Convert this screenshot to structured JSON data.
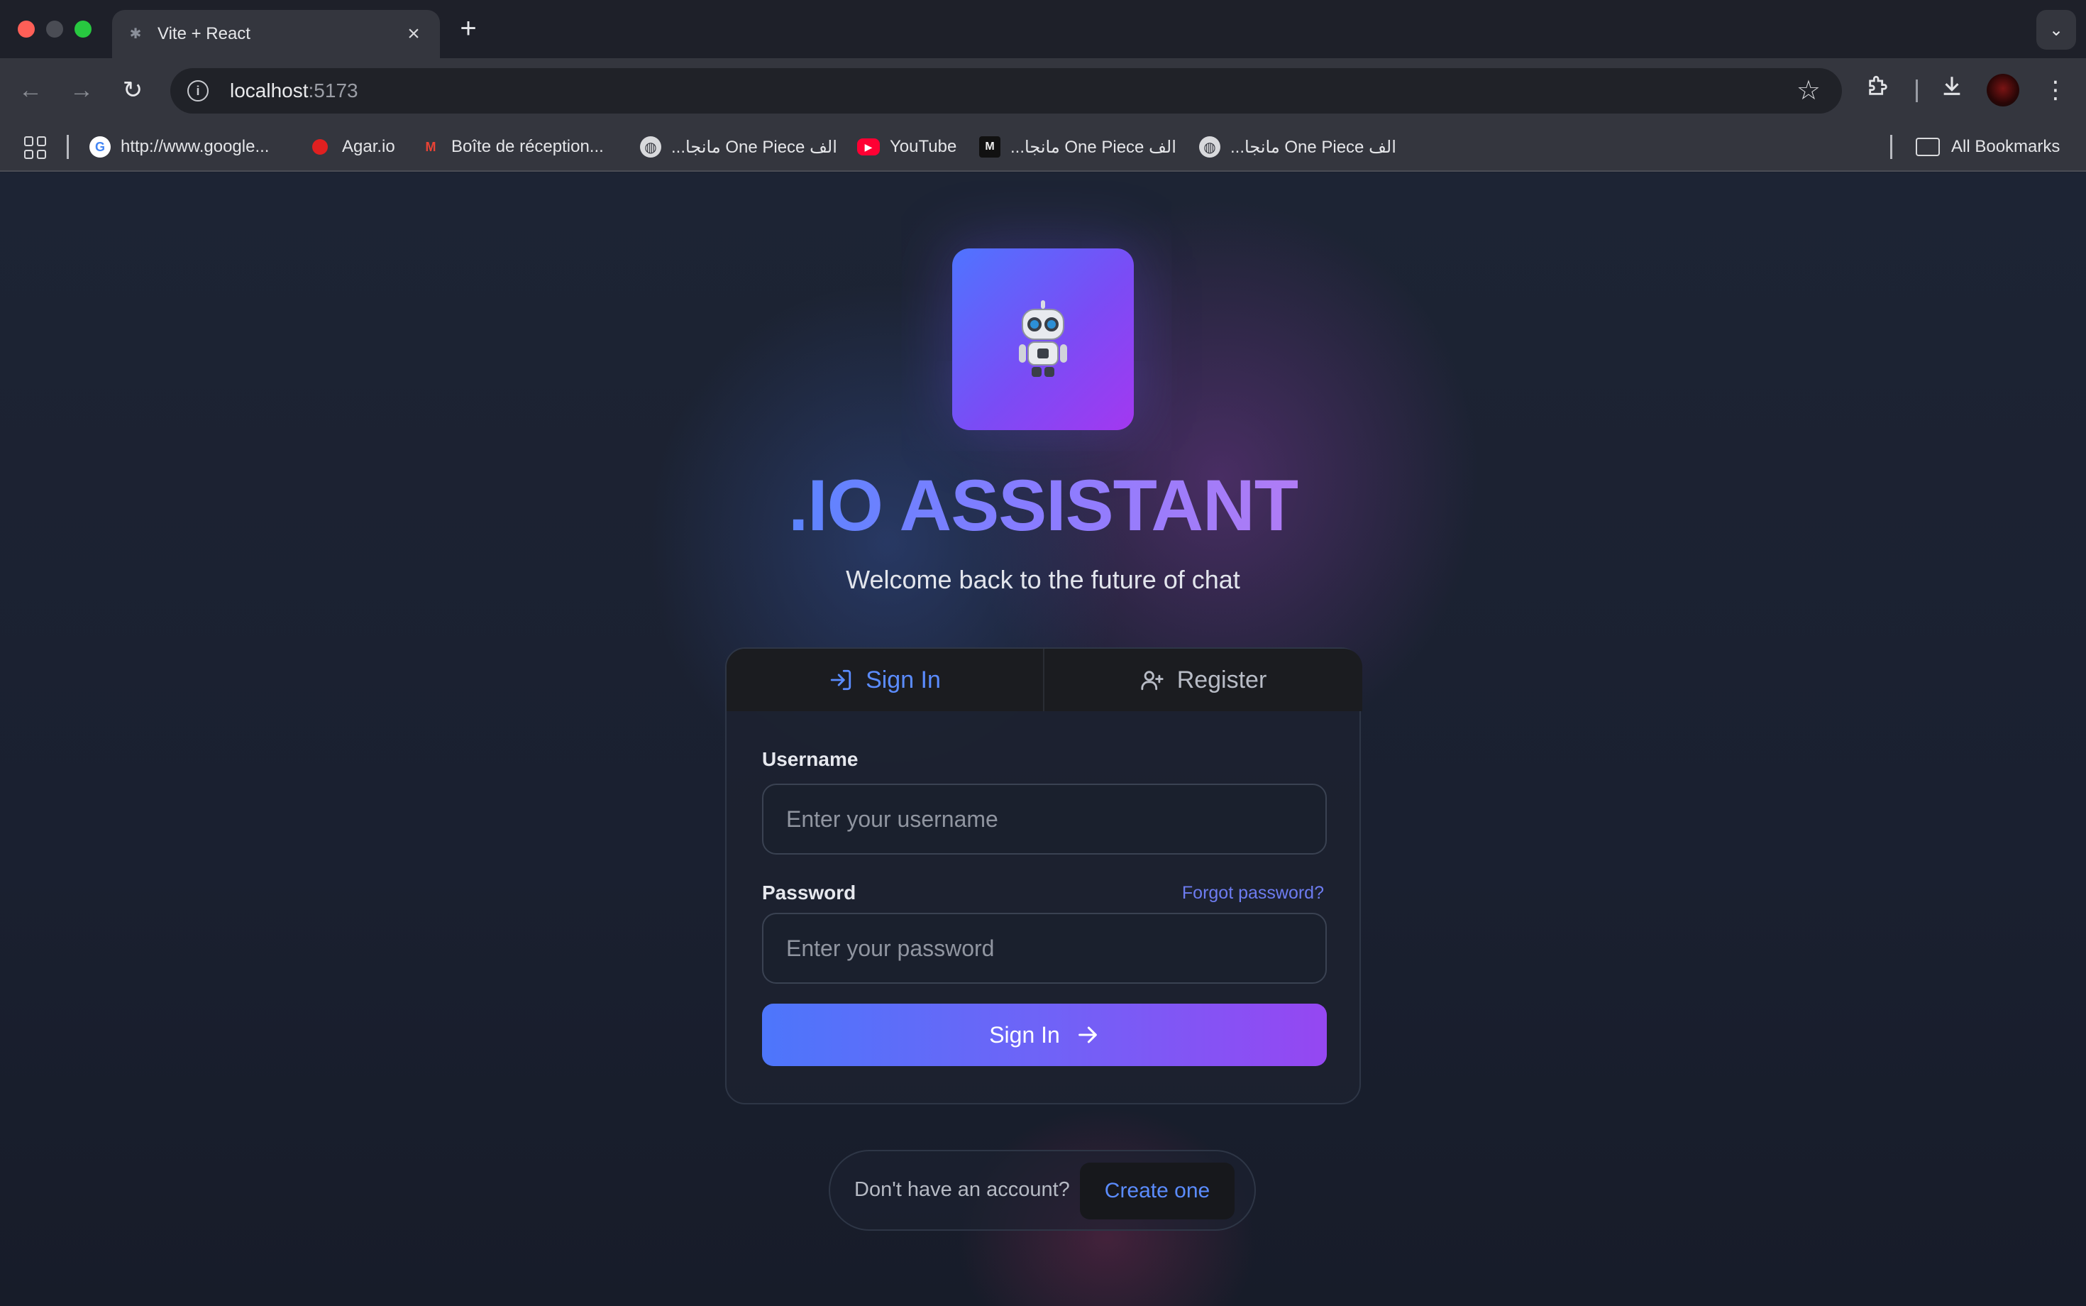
{
  "browser": {
    "tab": {
      "title": "Vite + React",
      "favicon": "vite-favicon-icon"
    },
    "new_tab_label": "+",
    "url": {
      "host": "localhost",
      "port": ":5173"
    },
    "bookmarks": [
      {
        "label": "http://www.google...",
        "icon": "google-icon"
      },
      {
        "label": "Agar.io",
        "icon": "agar-icon"
      },
      {
        "label": "Boîte de réception...",
        "icon": "gmail-icon"
      },
      {
        "label": "...مانجا One Piece الف",
        "icon": "globe-icon"
      },
      {
        "label": "YouTube",
        "icon": "youtube-icon"
      },
      {
        "label": "...مانجا One Piece الف",
        "icon": "manga-icon"
      },
      {
        "label": "...مانجا One Piece الف",
        "icon": "globe-icon"
      }
    ],
    "all_bookmarks": "All Bookmarks"
  },
  "app": {
    "title": ".IO ASSISTANT",
    "subtitle": "Welcome back to the future of chat",
    "tabs": [
      {
        "label": "Sign In",
        "active": true
      },
      {
        "label": "Register",
        "active": false
      }
    ],
    "form": {
      "username": {
        "label": "Username",
        "placeholder": "Enter your username",
        "value": ""
      },
      "password": {
        "label": "Password",
        "placeholder": "Enter your password",
        "value": ""
      },
      "forgot_label": "Forgot password?",
      "submit_label": "Sign In"
    },
    "footer": {
      "prompt": "Don't have an account?",
      "create_label": "Create one"
    },
    "colors": {
      "accent_blue": "#5b8cff",
      "gradient_start": "#4d76fb",
      "gradient_end": "#9547f2",
      "link": "#6d7cf0"
    }
  }
}
